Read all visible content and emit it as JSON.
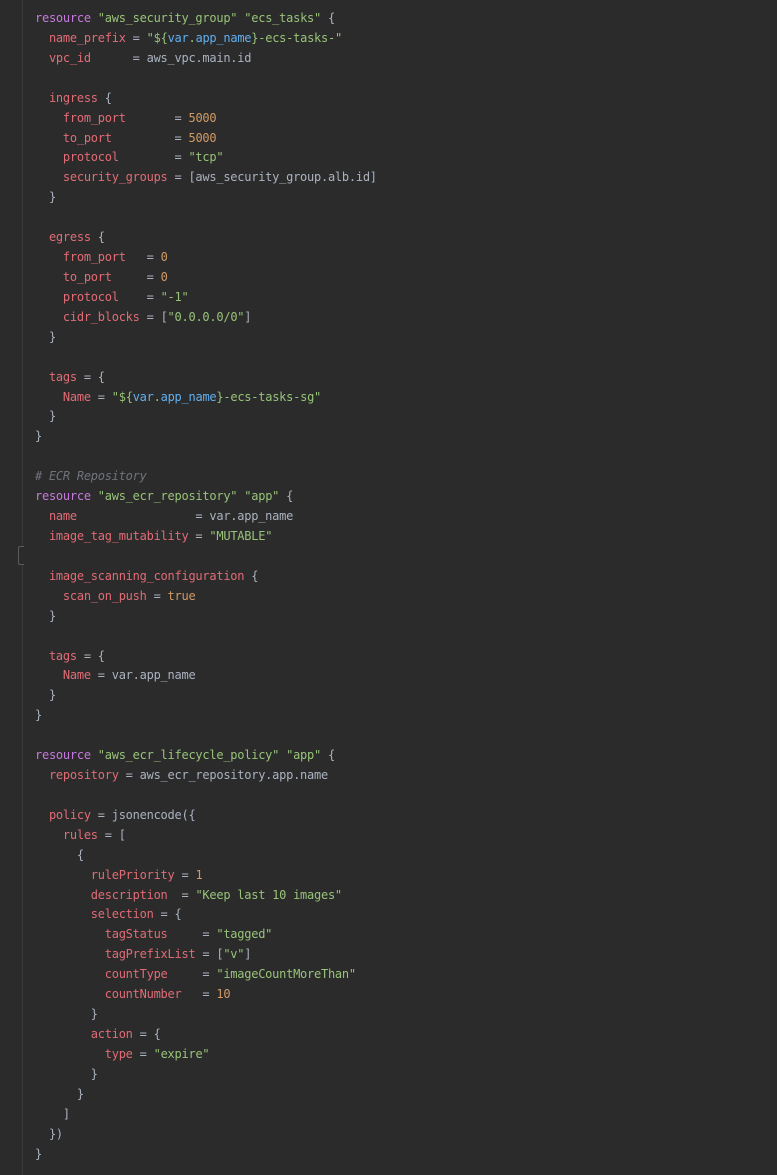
{
  "colors": {
    "background": "#2b2b2b",
    "keyword": "#c679dd",
    "string": "#98c379",
    "property": "#e06c75",
    "number": "#d19a66",
    "variable": "#61afef",
    "text": "#abb2bf",
    "comment": "#6f737a"
  },
  "lines": [
    [
      {
        "t": "resource",
        "c": "k"
      },
      {
        "t": " ",
        "c": "t"
      },
      {
        "t": "\"aws_security_group\"",
        "c": "s"
      },
      {
        "t": " ",
        "c": "t"
      },
      {
        "t": "\"ecs_tasks\"",
        "c": "s"
      },
      {
        "t": " {",
        "c": "t"
      }
    ],
    [
      {
        "t": "  ",
        "c": "t"
      },
      {
        "t": "name_prefix",
        "c": "p"
      },
      {
        "t": " = ",
        "c": "t"
      },
      {
        "t": "\"${",
        "c": "s"
      },
      {
        "t": "var",
        "c": "v"
      },
      {
        "t": ".",
        "c": "s"
      },
      {
        "t": "app_name",
        "c": "v"
      },
      {
        "t": "}-ecs-tasks-\"",
        "c": "s"
      }
    ],
    [
      {
        "t": "  ",
        "c": "t"
      },
      {
        "t": "vpc_id",
        "c": "p"
      },
      {
        "t": "      = aws_vpc.main.id",
        "c": "t"
      }
    ],
    [],
    [
      {
        "t": "  ",
        "c": "t"
      },
      {
        "t": "ingress",
        "c": "p"
      },
      {
        "t": " {",
        "c": "t"
      }
    ],
    [
      {
        "t": "    ",
        "c": "t"
      },
      {
        "t": "from_port",
        "c": "p"
      },
      {
        "t": "       = ",
        "c": "t"
      },
      {
        "t": "5000",
        "c": "n"
      }
    ],
    [
      {
        "t": "    ",
        "c": "t"
      },
      {
        "t": "to_port",
        "c": "p"
      },
      {
        "t": "         = ",
        "c": "t"
      },
      {
        "t": "5000",
        "c": "n"
      }
    ],
    [
      {
        "t": "    ",
        "c": "t"
      },
      {
        "t": "protocol",
        "c": "p"
      },
      {
        "t": "        = ",
        "c": "t"
      },
      {
        "t": "\"tcp\"",
        "c": "s"
      }
    ],
    [
      {
        "t": "    ",
        "c": "t"
      },
      {
        "t": "security_groups",
        "c": "p"
      },
      {
        "t": " = [aws_security_group.alb.id]",
        "c": "t"
      }
    ],
    [
      {
        "t": "  }",
        "c": "t"
      }
    ],
    [],
    [
      {
        "t": "  ",
        "c": "t"
      },
      {
        "t": "egress",
        "c": "p"
      },
      {
        "t": " {",
        "c": "t"
      }
    ],
    [
      {
        "t": "    ",
        "c": "t"
      },
      {
        "t": "from_port",
        "c": "p"
      },
      {
        "t": "   = ",
        "c": "t"
      },
      {
        "t": "0",
        "c": "n"
      }
    ],
    [
      {
        "t": "    ",
        "c": "t"
      },
      {
        "t": "to_port",
        "c": "p"
      },
      {
        "t": "     = ",
        "c": "t"
      },
      {
        "t": "0",
        "c": "n"
      }
    ],
    [
      {
        "t": "    ",
        "c": "t"
      },
      {
        "t": "protocol",
        "c": "p"
      },
      {
        "t": "    = ",
        "c": "t"
      },
      {
        "t": "\"-1\"",
        "c": "s"
      }
    ],
    [
      {
        "t": "    ",
        "c": "t"
      },
      {
        "t": "cidr_blocks",
        "c": "p"
      },
      {
        "t": " = [",
        "c": "t"
      },
      {
        "t": "\"0.0.0.0/0\"",
        "c": "s"
      },
      {
        "t": "]",
        "c": "t"
      }
    ],
    [
      {
        "t": "  }",
        "c": "t"
      }
    ],
    [],
    [
      {
        "t": "  ",
        "c": "t"
      },
      {
        "t": "tags",
        "c": "p"
      },
      {
        "t": " = {",
        "c": "t"
      }
    ],
    [
      {
        "t": "    ",
        "c": "t"
      },
      {
        "t": "Name",
        "c": "p"
      },
      {
        "t": " = ",
        "c": "t"
      },
      {
        "t": "\"${",
        "c": "s"
      },
      {
        "t": "var",
        "c": "v"
      },
      {
        "t": ".",
        "c": "s"
      },
      {
        "t": "app_name",
        "c": "v"
      },
      {
        "t": "}-ecs-tasks-sg\"",
        "c": "s"
      }
    ],
    [
      {
        "t": "  }",
        "c": "t"
      }
    ],
    [
      {
        "t": "}",
        "c": "t"
      }
    ],
    [],
    [
      {
        "t": "# ECR Repository",
        "c": "c"
      }
    ],
    [
      {
        "t": "resource",
        "c": "k"
      },
      {
        "t": " ",
        "c": "t"
      },
      {
        "t": "\"aws_ecr_repository\"",
        "c": "s"
      },
      {
        "t": " ",
        "c": "t"
      },
      {
        "t": "\"app\"",
        "c": "s"
      },
      {
        "t": " {",
        "c": "t"
      }
    ],
    [
      {
        "t": "  ",
        "c": "t"
      },
      {
        "t": "name",
        "c": "p"
      },
      {
        "t": "                 = var.app_name",
        "c": "t"
      }
    ],
    [
      {
        "t": "  ",
        "c": "t"
      },
      {
        "t": "image_tag_mutability",
        "c": "p"
      },
      {
        "t": " = ",
        "c": "t"
      },
      {
        "t": "\"MUTABLE\"",
        "c": "s"
      }
    ],
    [],
    [
      {
        "t": "  ",
        "c": "t"
      },
      {
        "t": "image_scanning_configuration",
        "c": "p"
      },
      {
        "t": " {",
        "c": "t"
      }
    ],
    [
      {
        "t": "    ",
        "c": "t"
      },
      {
        "t": "scan_on_push",
        "c": "p"
      },
      {
        "t": " = ",
        "c": "t"
      },
      {
        "t": "true",
        "c": "n"
      }
    ],
    [
      {
        "t": "  }",
        "c": "t"
      }
    ],
    [],
    [
      {
        "t": "  ",
        "c": "t"
      },
      {
        "t": "tags",
        "c": "p"
      },
      {
        "t": " = {",
        "c": "t"
      }
    ],
    [
      {
        "t": "    ",
        "c": "t"
      },
      {
        "t": "Name",
        "c": "p"
      },
      {
        "t": " = var.app_name",
        "c": "t"
      }
    ],
    [
      {
        "t": "  }",
        "c": "t"
      }
    ],
    [
      {
        "t": "}",
        "c": "t"
      }
    ],
    [],
    [
      {
        "t": "resource",
        "c": "k"
      },
      {
        "t": " ",
        "c": "t"
      },
      {
        "t": "\"aws_ecr_lifecycle_policy\"",
        "c": "s"
      },
      {
        "t": " ",
        "c": "t"
      },
      {
        "t": "\"app\"",
        "c": "s"
      },
      {
        "t": " {",
        "c": "t"
      }
    ],
    [
      {
        "t": "  ",
        "c": "t"
      },
      {
        "t": "repository",
        "c": "p"
      },
      {
        "t": " = aws_ecr_repository.app.name",
        "c": "t"
      }
    ],
    [],
    [
      {
        "t": "  ",
        "c": "t"
      },
      {
        "t": "policy",
        "c": "p"
      },
      {
        "t": " = jsonencode({",
        "c": "t"
      }
    ],
    [
      {
        "t": "    ",
        "c": "t"
      },
      {
        "t": "rules",
        "c": "p"
      },
      {
        "t": " = [",
        "c": "t"
      }
    ],
    [
      {
        "t": "      {",
        "c": "t"
      }
    ],
    [
      {
        "t": "        ",
        "c": "t"
      },
      {
        "t": "rulePriority",
        "c": "p"
      },
      {
        "t": " = ",
        "c": "t"
      },
      {
        "t": "1",
        "c": "n"
      }
    ],
    [
      {
        "t": "        ",
        "c": "t"
      },
      {
        "t": "description",
        "c": "p"
      },
      {
        "t": "  = ",
        "c": "t"
      },
      {
        "t": "\"Keep last 10 images\"",
        "c": "s"
      }
    ],
    [
      {
        "t": "        ",
        "c": "t"
      },
      {
        "t": "selection",
        "c": "p"
      },
      {
        "t": " = {",
        "c": "t"
      }
    ],
    [
      {
        "t": "          ",
        "c": "t"
      },
      {
        "t": "tagStatus",
        "c": "p"
      },
      {
        "t": "     = ",
        "c": "t"
      },
      {
        "t": "\"tagged\"",
        "c": "s"
      }
    ],
    [
      {
        "t": "          ",
        "c": "t"
      },
      {
        "t": "tagPrefixList",
        "c": "p"
      },
      {
        "t": " = [",
        "c": "t"
      },
      {
        "t": "\"v\"",
        "c": "s"
      },
      {
        "t": "]",
        "c": "t"
      }
    ],
    [
      {
        "t": "          ",
        "c": "t"
      },
      {
        "t": "countType",
        "c": "p"
      },
      {
        "t": "     = ",
        "c": "t"
      },
      {
        "t": "\"imageCountMoreThan\"",
        "c": "s"
      }
    ],
    [
      {
        "t": "          ",
        "c": "t"
      },
      {
        "t": "countNumber",
        "c": "p"
      },
      {
        "t": "   = ",
        "c": "t"
      },
      {
        "t": "10",
        "c": "n"
      }
    ],
    [
      {
        "t": "        }",
        "c": "t"
      }
    ],
    [
      {
        "t": "        ",
        "c": "t"
      },
      {
        "t": "action",
        "c": "p"
      },
      {
        "t": " = {",
        "c": "t"
      }
    ],
    [
      {
        "t": "          ",
        "c": "t"
      },
      {
        "t": "type",
        "c": "p"
      },
      {
        "t": " = ",
        "c": "t"
      },
      {
        "t": "\"expire\"",
        "c": "s"
      }
    ],
    [
      {
        "t": "        }",
        "c": "t"
      }
    ],
    [
      {
        "t": "      }",
        "c": "t"
      }
    ],
    [
      {
        "t": "    ]",
        "c": "t"
      }
    ],
    [
      {
        "t": "  })",
        "c": "t"
      }
    ],
    [
      {
        "t": "}",
        "c": "t"
      }
    ]
  ]
}
